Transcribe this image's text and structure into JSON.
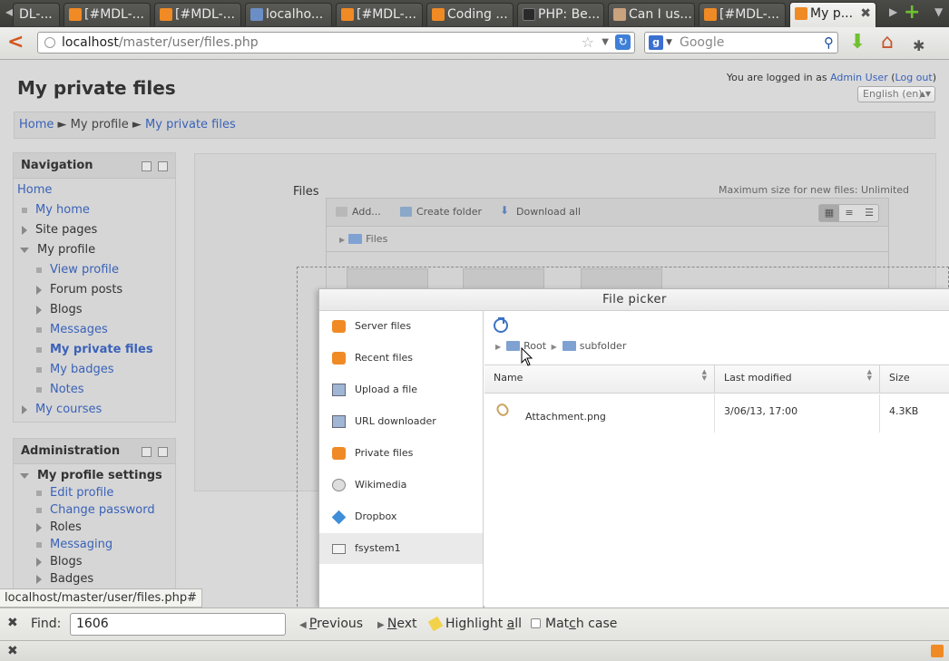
{
  "browser": {
    "tabs": [
      {
        "label": "DL-..."
      },
      {
        "label": "[#MDL-..."
      },
      {
        "label": "[#MDL-..."
      },
      {
        "label": "localho..."
      },
      {
        "label": "[#MDL-..."
      },
      {
        "label": "Coding ..."
      },
      {
        "label": "PHP: Be..."
      },
      {
        "label": "Can I us..."
      },
      {
        "label": "[#MDL-..."
      },
      {
        "label": "My p..."
      }
    ],
    "close_glyph": "✖",
    "url_host": "localhost",
    "url_path": "/master/user/files.php",
    "search_placeholder": "Google",
    "search_engine_letter": "g",
    "status_url": "localhost/master/user/files.php#"
  },
  "page": {
    "title": "My private files",
    "login_prefix": "You are logged in as ",
    "login_user": "Admin User",
    "login_open": " (",
    "login_logout": "Log out",
    "login_close": ")",
    "language": "English (en)",
    "breadcrumb": {
      "home": "Home",
      "sep1": " ► ",
      "profile": "My profile",
      "sep2": " ► ",
      "current": "My private files"
    }
  },
  "navigation": {
    "title": "Navigation",
    "items": [
      {
        "label": "Home"
      },
      {
        "label": "My home"
      },
      {
        "label": "Site pages"
      },
      {
        "label": "My profile"
      },
      {
        "label": "View profile"
      },
      {
        "label": "Forum posts"
      },
      {
        "label": "Blogs"
      },
      {
        "label": "Messages"
      },
      {
        "label": "My private files"
      },
      {
        "label": "My badges"
      },
      {
        "label": "Notes"
      },
      {
        "label": "My courses"
      }
    ]
  },
  "administration": {
    "title": "Administration",
    "items": [
      {
        "label": "My profile settings"
      },
      {
        "label": "Edit profile"
      },
      {
        "label": "Change password"
      },
      {
        "label": "Roles"
      },
      {
        "label": "Messaging"
      },
      {
        "label": "Blogs"
      },
      {
        "label": "Badges"
      }
    ]
  },
  "filemanager": {
    "label": "Files",
    "max_size": "Maximum size for new files: Unlimited",
    "add": "Add...",
    "create_folder": "Create folder",
    "download_all": "Download all",
    "path_root": "Files"
  },
  "filepicker": {
    "title": "File picker",
    "repositories": [
      {
        "label": "Server files",
        "icon": "moodle-icon"
      },
      {
        "label": "Recent files",
        "icon": "moodle-icon"
      },
      {
        "label": "Upload a file",
        "icon": "upload-icon"
      },
      {
        "label": "URL downloader",
        "icon": "download-icon"
      },
      {
        "label": "Private files",
        "icon": "moodle-icon"
      },
      {
        "label": "Wikimedia",
        "icon": "wikimedia-icon"
      },
      {
        "label": "Dropbox",
        "icon": "dropbox-icon"
      },
      {
        "label": "fsystem1",
        "icon": "drive-icon"
      }
    ],
    "active_repository": "fsystem1",
    "path": [
      "Root",
      "subfolder"
    ],
    "columns": {
      "name": "Name",
      "modified": "Last modified",
      "size": "Size"
    },
    "files": [
      {
        "name": "Attachment.png",
        "modified": "3/06/13, 17:00",
        "size": "4.3KB"
      }
    ]
  },
  "findbar": {
    "label": "Find:",
    "value": "1606",
    "previous_u": "P",
    "previous_rest": "revious",
    "next_u": "N",
    "next_rest": "ext",
    "highlight_pre": "Highlight ",
    "highlight_u": "a",
    "highlight_rest": "ll",
    "matchcase_pre": "Mat",
    "matchcase_u": "c",
    "matchcase_rest": "h case"
  },
  "colors": {
    "link": "#3a62b8",
    "moodle_orange": "#f08a24",
    "folder_blue": "#7fa2d2"
  }
}
